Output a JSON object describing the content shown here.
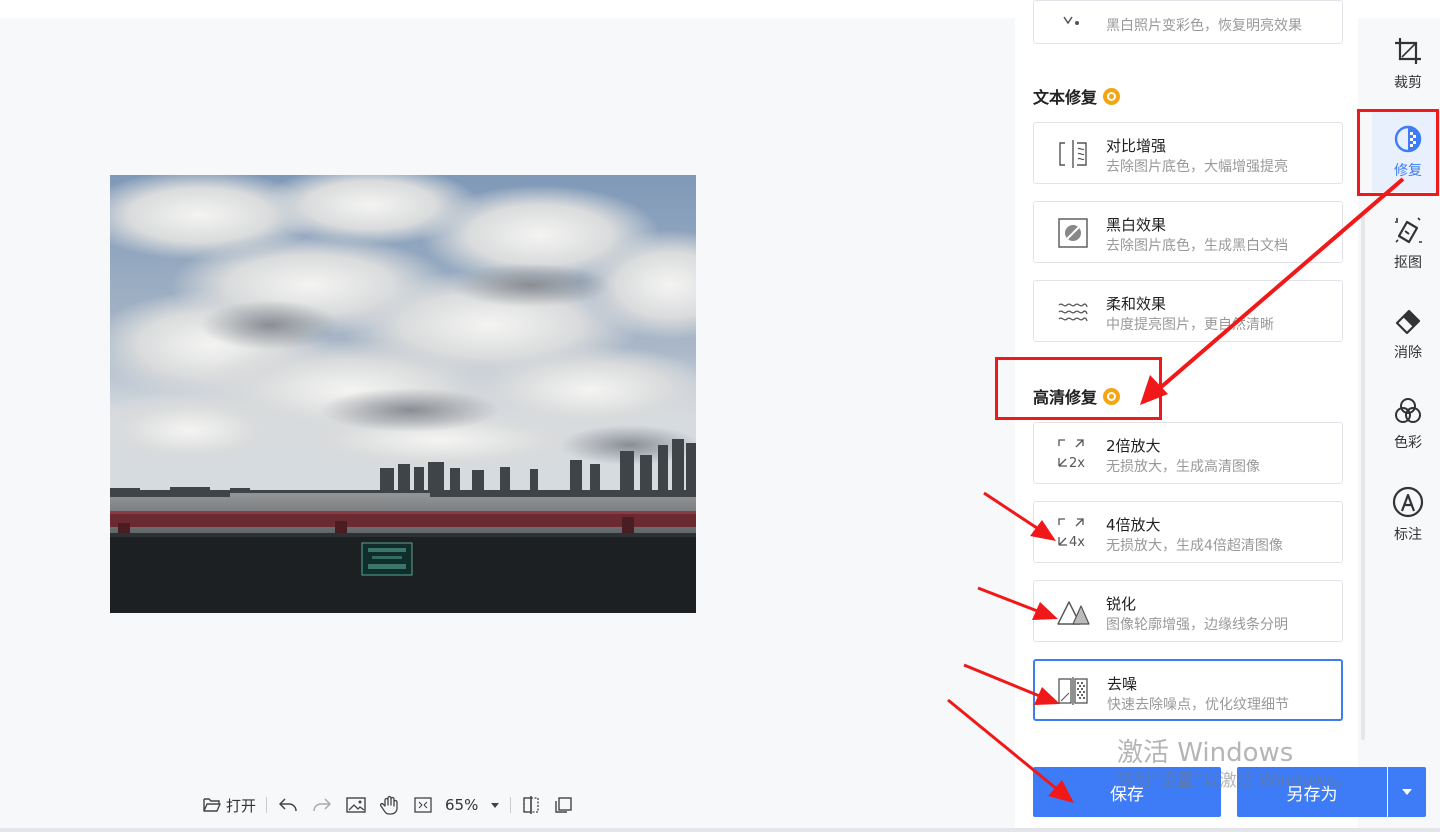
{
  "toolbar": {
    "open_label": "打开",
    "zoom_value": "65%"
  },
  "panel": {
    "partial_card_desc": "黑白照片变彩色，恢复明亮效果",
    "section_text_repair": "文本修复",
    "text_repair_cards": [
      {
        "title": "对比增强",
        "desc": "去除图片底色，大幅增强提亮",
        "icon": "contrast-enhance-icon"
      },
      {
        "title": "黑白效果",
        "desc": "去除图片底色，生成黑白文档",
        "icon": "black-white-icon"
      },
      {
        "title": "柔和效果",
        "desc": "中度提亮图片，更自然清晰",
        "icon": "soft-wave-icon"
      }
    ],
    "section_hd_repair": "高清修复",
    "hd_cards": [
      {
        "title": "2倍放大",
        "desc": "无损放大，生成高清图像",
        "icon": "upscale-2x-icon",
        "badge": "2x"
      },
      {
        "title": "4倍放大",
        "desc": "无损放大，生成4倍超清图像",
        "icon": "upscale-4x-icon",
        "badge": "4x"
      },
      {
        "title": "锐化",
        "desc": "图像轮廓增强，边缘线条分明",
        "icon": "sharpen-icon"
      },
      {
        "title": "去噪",
        "desc": "快速去除噪点，优化纹理细节",
        "icon": "denoise-icon",
        "selected": true
      }
    ]
  },
  "rail": {
    "items": [
      {
        "label": "裁剪",
        "icon": "crop-icon"
      },
      {
        "label": "修复",
        "icon": "repair-icon",
        "active": true
      },
      {
        "label": "抠图",
        "icon": "cutout-icon"
      },
      {
        "label": "消除",
        "icon": "eraser-icon"
      },
      {
        "label": "色彩",
        "icon": "color-icon"
      },
      {
        "label": "标注",
        "icon": "annotate-icon"
      }
    ]
  },
  "buttons": {
    "save": "保存",
    "save_as": "另存为"
  },
  "watermark": {
    "line1": "激活 Windows",
    "line2": "转到“设置”以激活 Windows。"
  },
  "colors": {
    "accent": "#3d7cf6",
    "annotation_red": "#f01818",
    "vip_gold": "#f2a516"
  }
}
